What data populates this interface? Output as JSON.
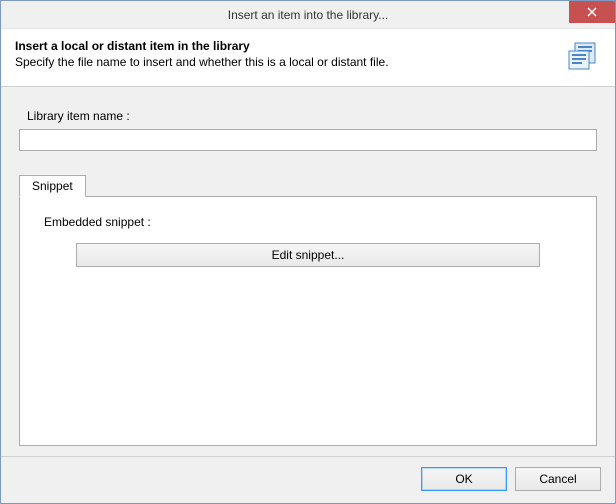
{
  "window": {
    "title": "Insert an item into the library..."
  },
  "header": {
    "title": "Insert a local or distant item in the library",
    "description": "Specify the file name to insert and whether this is a local or distant file."
  },
  "form": {
    "library_item_name_label": "Library item name :",
    "library_item_name_value": ""
  },
  "tabs": {
    "snippet_label": "Snippet"
  },
  "snippet_panel": {
    "embedded_label": "Embedded snippet :",
    "edit_button_label": "Edit snippet..."
  },
  "footer": {
    "ok_label": "OK",
    "cancel_label": "Cancel"
  }
}
